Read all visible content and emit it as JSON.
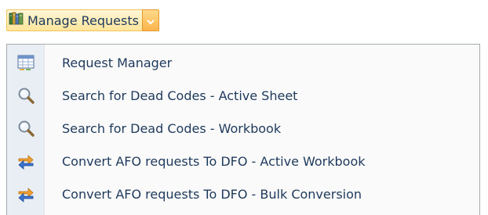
{
  "split_button": {
    "label": "Manage Requests",
    "icon": "books-icon",
    "arrow_icon": "chevron-down-icon"
  },
  "menu": {
    "items": [
      {
        "label": "Request Manager",
        "icon": "table-grid-icon"
      },
      {
        "label": "Search for Dead Codes - Active Sheet",
        "icon": "magnifier-icon"
      },
      {
        "label": "Search for Dead Codes - Workbook",
        "icon": "magnifier-icon"
      },
      {
        "label": "Convert AFO requests To DFO - Active Workbook",
        "icon": "swap-arrows-icon"
      },
      {
        "label": "Convert AFO requests To DFO - Bulk Conversion",
        "icon": "swap-arrows-icon"
      }
    ]
  },
  "colors": {
    "text": "#1e395b",
    "highlight_top": "#fff7d8",
    "highlight_bottom": "#ffe59a",
    "arrow_orange": "#ffb54a",
    "gutter": "#e9eef5"
  }
}
